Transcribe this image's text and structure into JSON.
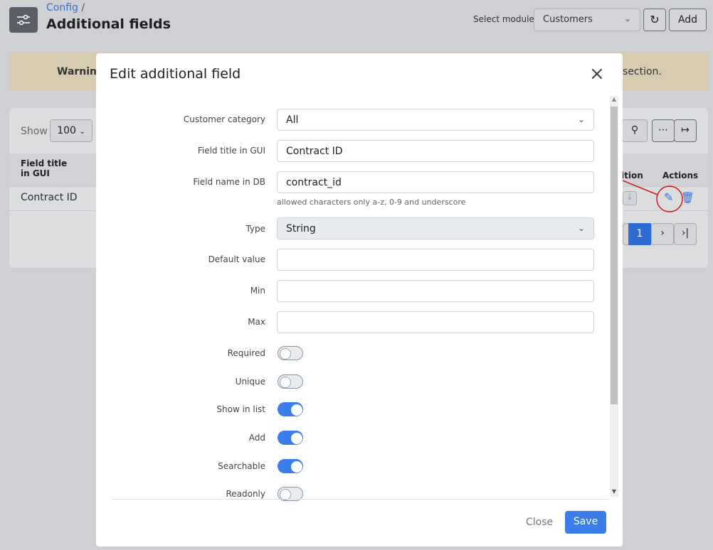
{
  "header": {
    "breadcrumb": "Config",
    "separator": "/",
    "title": "Additional fields",
    "module_label": "Select module",
    "module_value": "Customers",
    "add_label": "Add"
  },
  "warning": {
    "left_text": "Warning",
    "right_text": "section."
  },
  "table": {
    "show_label": "Show",
    "page_size": "100",
    "col_title": "Field title in GUI",
    "col_position": "ition",
    "col_actions": "Actions",
    "rows": [
      {
        "title": "Contract ID"
      }
    ],
    "current_page": "1"
  },
  "modal": {
    "title": "Edit additional field",
    "fields": {
      "category_label": "Customer category",
      "category_value": "All",
      "title_label": "Field title in GUI",
      "title_value": "Contract ID",
      "name_label": "Field name in DB",
      "name_value": "contract_id",
      "name_hint": "allowed characters only a-z, 0-9 and underscore",
      "type_label": "Type",
      "type_value": "String",
      "default_label": "Default value",
      "min_label": "Min",
      "max_label": "Max"
    },
    "toggles": [
      {
        "label": "Required",
        "on": false
      },
      {
        "label": "Unique",
        "on": false
      },
      {
        "label": "Show in list",
        "on": true
      },
      {
        "label": "Add",
        "on": true
      },
      {
        "label": "Searchable",
        "on": true
      },
      {
        "label": "Readonly",
        "on": false
      }
    ],
    "close_label": "Close",
    "save_label": "Save"
  },
  "colors": {
    "accent": "#3b7de9",
    "annotation": "#d0161b"
  }
}
